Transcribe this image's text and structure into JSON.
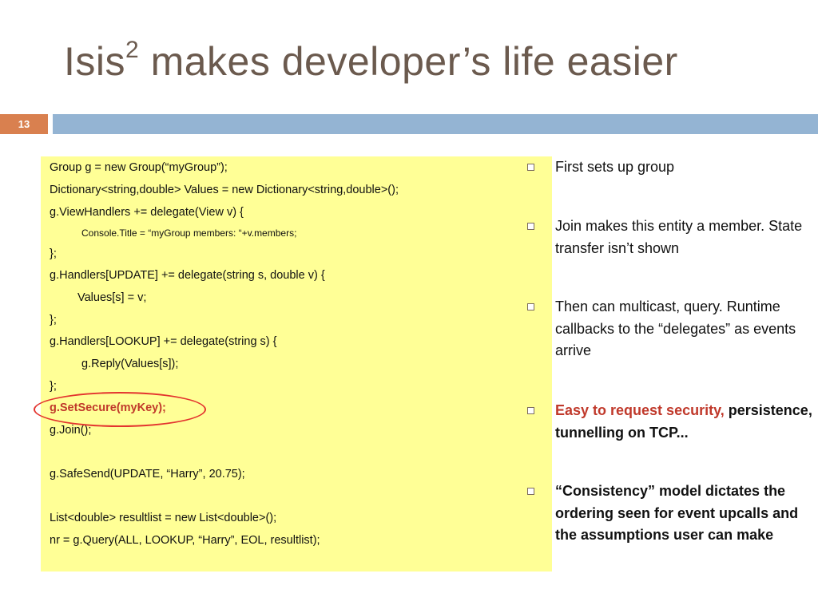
{
  "slide": {
    "title_main": "Isis",
    "title_sup": "2",
    "title_rest": " makes developer’s life easier",
    "number": "13"
  },
  "code": [
    "Group g = new Group(“myGroup”);",
    "Dictionary<string,double> Values = new Dictionary<string,double>();",
    "g.ViewHandlers += delegate(View v) {",
    "Console.Title = “myGroup members: “+v.members;",
    "};",
    "g.Handlers[UPDATE] += delegate(string s, double v) {",
    "Values[s] = v;",
    "};",
    "g.Handlers[LOOKUP] += delegate(string s) {",
    "g.Reply(Values[s]);",
    "};",
    "g.SetSecure(myKey);",
    "g.Join();",
    "g.SafeSend(UPDATE, “Harry”, 20.75);",
    "List<double> resultlist = new List<double>();",
    "nr = g.Query(ALL, LOOKUP, “Harry”, EOL, resultlist);"
  ],
  "bullets": [
    "First sets up group",
    "Join makes this entity a member.  State transfer isn’t shown",
    "Then can multicast, query.  Runtime callbacks to the “delegates” as events arrive",
    {
      "red": "Easy to request security,",
      "rest": " persistence, tunnelling on TCP..."
    },
    "“Consistency” model dictates the ordering seen for event upcalls and the assumptions user can make"
  ],
  "colors": {
    "title": "#6b5a4e",
    "number_box": "#d9804f",
    "top_bar": "#94b4d3",
    "code_bg": "#ffff96",
    "highlight_red": "#c0392b",
    "ellipse": "#e3342f"
  }
}
